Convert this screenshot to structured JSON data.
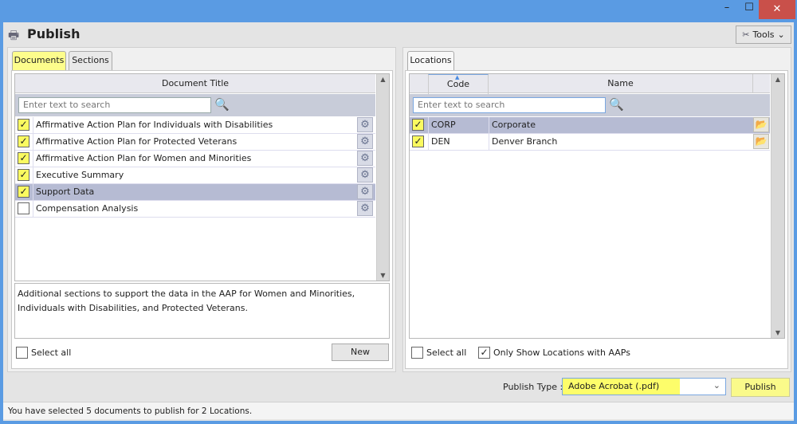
{
  "window": {
    "minimize": "–",
    "maximize": "☐",
    "close": "✕"
  },
  "header": {
    "title": "Publish",
    "tools_label": "Tools"
  },
  "left": {
    "tabs": [
      {
        "label": "Documents"
      },
      {
        "label": "Sections"
      }
    ],
    "column_title": "Document Title",
    "search_placeholder": "Enter text to search",
    "rows": [
      {
        "title": "Affirmative Action Plan for Individuals with Disabilities",
        "checked": true
      },
      {
        "title": "Affirmative Action Plan for Protected Veterans",
        "checked": true
      },
      {
        "title": "Affirmative Action Plan for Women and Minorities",
        "checked": true
      },
      {
        "title": "Executive Summary",
        "checked": true
      },
      {
        "title": "Support Data",
        "checked": true,
        "selected": true
      },
      {
        "title": "Compensation Analysis",
        "checked": false
      }
    ],
    "description": "Additional sections to support the data in the AAP for Women and Minorities, Individuals with Disabilities, and Protected Veterans.",
    "select_all": "Select all",
    "new_button": "New"
  },
  "right": {
    "tabs": [
      {
        "label": "Locations"
      }
    ],
    "col_code": "Code",
    "col_name": "Name",
    "search_placeholder": "Enter text to search",
    "rows": [
      {
        "code": "CORP",
        "name": "Corporate",
        "checked": true,
        "selected": true
      },
      {
        "code": "DEN",
        "name": "Denver Branch",
        "checked": true
      }
    ],
    "select_all": "Select all",
    "only_show": "Only Show Locations with AAPs"
  },
  "footer": {
    "publish_type_label": "Publish Type :",
    "publish_type_value": "Adobe Acrobat (.pdf)",
    "publish_button": "Publish"
  },
  "status": "You have selected 5 documents to publish for 2 Locations."
}
